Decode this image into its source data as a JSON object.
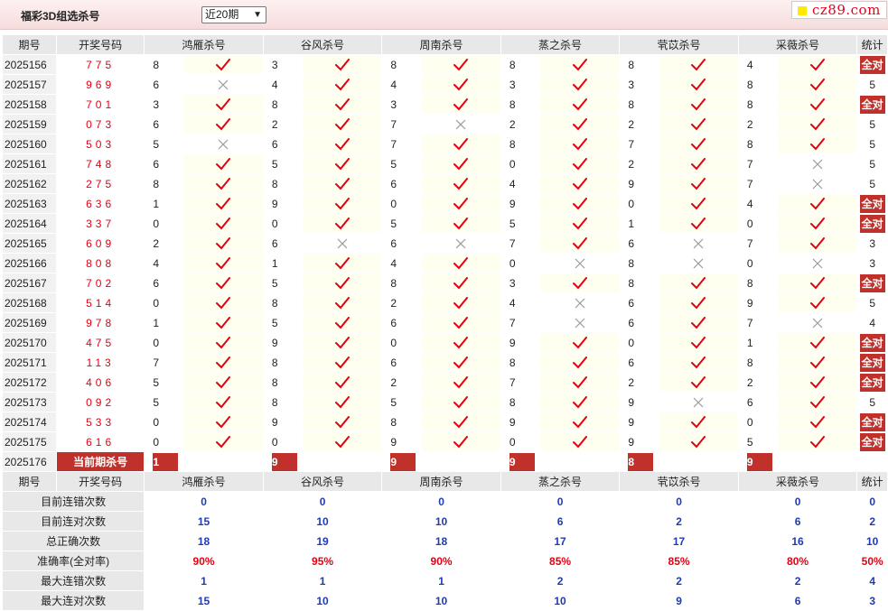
{
  "header": {
    "title": "福彩3D组选杀号",
    "period_select": "近20期",
    "brand": "cz89.com"
  },
  "table": {
    "col_period": "期号",
    "col_draw": "开奖号码",
    "col_stat": "统计",
    "experts": [
      "鸿雁杀号",
      "谷风杀号",
      "周南杀号",
      "蒸之杀号",
      "茕苡杀号",
      "采薇杀号"
    ],
    "rows": [
      {
        "p": "2025156",
        "d": "775",
        "n": [
          8,
          3,
          8,
          8,
          8,
          4
        ],
        "m": [
          1,
          1,
          1,
          1,
          1,
          1
        ],
        "s": "全对"
      },
      {
        "p": "2025157",
        "d": "969",
        "n": [
          6,
          4,
          4,
          3,
          3,
          8
        ],
        "m": [
          0,
          1,
          1,
          1,
          1,
          1
        ],
        "s": "5"
      },
      {
        "p": "2025158",
        "d": "701",
        "n": [
          3,
          8,
          3,
          8,
          8,
          8
        ],
        "m": [
          1,
          1,
          1,
          1,
          1,
          1
        ],
        "s": "全对"
      },
      {
        "p": "2025159",
        "d": "073",
        "n": [
          6,
          2,
          7,
          2,
          2,
          2
        ],
        "m": [
          1,
          1,
          0,
          1,
          1,
          1
        ],
        "s": "5"
      },
      {
        "p": "2025160",
        "d": "503",
        "n": [
          5,
          6,
          7,
          8,
          7,
          8
        ],
        "m": [
          0,
          1,
          1,
          1,
          1,
          1
        ],
        "s": "5"
      },
      {
        "p": "2025161",
        "d": "748",
        "n": [
          6,
          5,
          5,
          0,
          2,
          7
        ],
        "m": [
          1,
          1,
          1,
          1,
          1,
          0
        ],
        "s": "5"
      },
      {
        "p": "2025162",
        "d": "275",
        "n": [
          8,
          8,
          6,
          4,
          9,
          7
        ],
        "m": [
          1,
          1,
          1,
          1,
          1,
          0
        ],
        "s": "5"
      },
      {
        "p": "2025163",
        "d": "636",
        "n": [
          1,
          9,
          0,
          9,
          0,
          4
        ],
        "m": [
          1,
          1,
          1,
          1,
          1,
          1
        ],
        "s": "全对"
      },
      {
        "p": "2025164",
        "d": "337",
        "n": [
          0,
          0,
          5,
          5,
          1,
          0
        ],
        "m": [
          1,
          1,
          1,
          1,
          1,
          1
        ],
        "s": "全对"
      },
      {
        "p": "2025165",
        "d": "609",
        "n": [
          2,
          6,
          6,
          7,
          6,
          7
        ],
        "m": [
          1,
          0,
          0,
          1,
          0,
          1
        ],
        "s": "3"
      },
      {
        "p": "2025166",
        "d": "808",
        "n": [
          4,
          1,
          4,
          0,
          8,
          0
        ],
        "m": [
          1,
          1,
          1,
          0,
          0,
          0
        ],
        "s": "3"
      },
      {
        "p": "2025167",
        "d": "702",
        "n": [
          6,
          5,
          8,
          3,
          8,
          8
        ],
        "m": [
          1,
          1,
          1,
          1,
          1,
          1
        ],
        "s": "全对"
      },
      {
        "p": "2025168",
        "d": "514",
        "n": [
          0,
          8,
          2,
          4,
          6,
          9
        ],
        "m": [
          1,
          1,
          1,
          0,
          1,
          1
        ],
        "s": "5"
      },
      {
        "p": "2025169",
        "d": "978",
        "n": [
          1,
          5,
          6,
          7,
          6,
          7
        ],
        "m": [
          1,
          1,
          1,
          0,
          1,
          0
        ],
        "s": "4"
      },
      {
        "p": "2025170",
        "d": "475",
        "n": [
          0,
          9,
          0,
          9,
          0,
          1
        ],
        "m": [
          1,
          1,
          1,
          1,
          1,
          1
        ],
        "s": "全对"
      },
      {
        "p": "2025171",
        "d": "113",
        "n": [
          7,
          8,
          6,
          8,
          6,
          8
        ],
        "m": [
          1,
          1,
          1,
          1,
          1,
          1
        ],
        "s": "全对"
      },
      {
        "p": "2025172",
        "d": "406",
        "n": [
          5,
          8,
          2,
          7,
          2,
          2
        ],
        "m": [
          1,
          1,
          1,
          1,
          1,
          1
        ],
        "s": "全对"
      },
      {
        "p": "2025173",
        "d": "092",
        "n": [
          5,
          8,
          5,
          8,
          9,
          6
        ],
        "m": [
          1,
          1,
          1,
          1,
          0,
          1
        ],
        "s": "5"
      },
      {
        "p": "2025174",
        "d": "533",
        "n": [
          0,
          9,
          8,
          9,
          9,
          0
        ],
        "m": [
          1,
          1,
          1,
          1,
          1,
          1
        ],
        "s": "全对"
      },
      {
        "p": "2025175",
        "d": "616",
        "n": [
          0,
          0,
          9,
          0,
          9,
          5
        ],
        "m": [
          1,
          1,
          1,
          1,
          1,
          1
        ],
        "s": "全对"
      }
    ],
    "current": {
      "p": "2025176",
      "label": "当前期杀号",
      "n": [
        1,
        9,
        9,
        9,
        8,
        9
      ]
    }
  },
  "summary": {
    "rows": [
      {
        "label": "目前连错次数",
        "v": [
          "0",
          "0",
          "0",
          "0",
          "0",
          "0",
          "0"
        ]
      },
      {
        "label": "目前连对次数",
        "v": [
          "15",
          "10",
          "10",
          "6",
          "2",
          "6",
          "2"
        ]
      },
      {
        "label": "总正确次数",
        "v": [
          "18",
          "19",
          "18",
          "17",
          "17",
          "16",
          "10"
        ]
      },
      {
        "label": "准确率(全对率)",
        "v": [
          "90%",
          "95%",
          "90%",
          "85%",
          "85%",
          "80%",
          "50%"
        ],
        "red": true
      },
      {
        "label": "最大连错次数",
        "v": [
          "1",
          "1",
          "1",
          "2",
          "2",
          "2",
          "4"
        ]
      },
      {
        "label": "最大连对次数",
        "v": [
          "15",
          "10",
          "10",
          "10",
          "9",
          "6",
          "3"
        ]
      }
    ]
  },
  "colors": {
    "red": "#e60012",
    "box": "#c0312b",
    "blue": "#1f3bb3",
    "mark_bg": "#fffff0"
  }
}
